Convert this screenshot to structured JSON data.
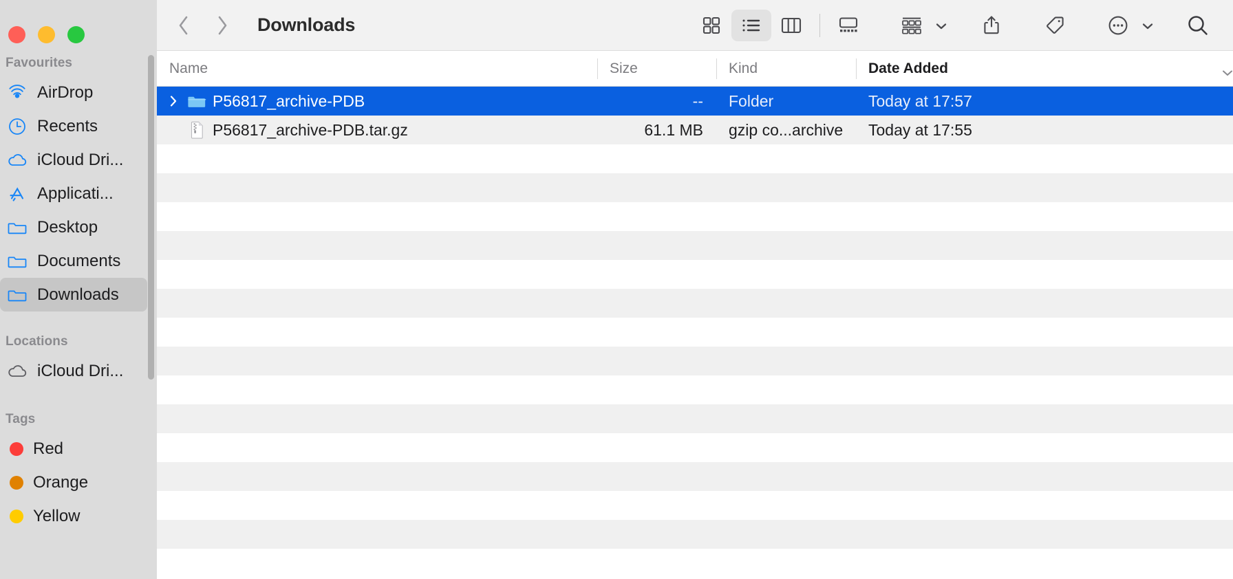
{
  "window": {
    "traffic_lights": [
      {
        "name": "close",
        "color": "#ff5f57"
      },
      {
        "name": "minimize",
        "color": "#febc2e"
      },
      {
        "name": "zoom",
        "color": "#28c840"
      }
    ]
  },
  "toolbar": {
    "back_label": "Back",
    "forward_label": "Forward",
    "title": "Downloads",
    "view_modes": [
      {
        "name": "icon-view",
        "label": "Icon View",
        "active": false
      },
      {
        "name": "list-view",
        "label": "List View",
        "active": true
      },
      {
        "name": "column-view",
        "label": "Column View",
        "active": false
      },
      {
        "name": "gallery-view",
        "label": "Gallery View",
        "active": false
      }
    ],
    "group_label": "Group",
    "share_label": "Share",
    "tags_label": "Tags",
    "more_label": "More",
    "search_label": "Search"
  },
  "sidebar": {
    "sections": [
      {
        "title": "Favourites",
        "items": [
          {
            "label": "AirDrop",
            "icon": "airdrop-icon"
          },
          {
            "label": "Recents",
            "icon": "clock-icon"
          },
          {
            "label": "iCloud Dri...",
            "icon": "cloud-icon"
          },
          {
            "label": "Applicati...",
            "icon": "appstore-icon"
          },
          {
            "label": "Desktop",
            "icon": "folder-icon"
          },
          {
            "label": "Documents",
            "icon": "folder-icon"
          },
          {
            "label": "Downloads",
            "icon": "folder-icon",
            "selected": true
          }
        ]
      },
      {
        "title": "Locations",
        "items": [
          {
            "label": "iCloud Dri...",
            "icon": "cloud-grey-icon"
          }
        ]
      },
      {
        "title": "Tags",
        "items": [
          {
            "label": "Red",
            "color": "#fc3d39"
          },
          {
            "label": "Orange",
            "color": "#e08100"
          },
          {
            "label": "Yellow",
            "color": "#ffcc00"
          }
        ]
      }
    ]
  },
  "file_list": {
    "columns": [
      {
        "key": "name",
        "label": "Name",
        "sorted": false
      },
      {
        "key": "size",
        "label": "Size",
        "sorted": false
      },
      {
        "key": "kind",
        "label": "Kind",
        "sorted": false
      },
      {
        "key": "date",
        "label": "Date Added",
        "sorted": true
      }
    ],
    "rows": [
      {
        "name": "P56817_archive-PDB",
        "size": "--",
        "kind": "Folder",
        "date": "Today at 17:57",
        "icon": "folder-icon",
        "expandable": true,
        "selected": true
      },
      {
        "name": "P56817_archive-PDB.tar.gz",
        "size": "61.1 MB",
        "kind": "gzip co...archive",
        "date": "Today at 17:55",
        "icon": "archive-file-icon",
        "expandable": false,
        "selected": false
      }
    ],
    "empty_row_count": 14
  },
  "colors": {
    "selection_blue": "#0a60e0",
    "sidebar_bg": "#dcdcdc",
    "toolbar_bg": "#f2f2f2",
    "stripe": "#f0f0f0",
    "accent_blue": "#1886f7"
  }
}
